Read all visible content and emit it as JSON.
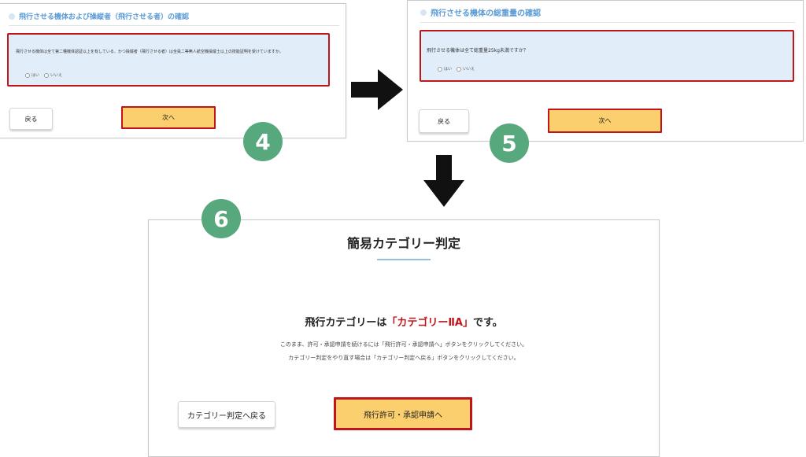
{
  "step4": {
    "badge": "4",
    "section_title": "飛行させる機体および操縦者（飛行させる者）の確認",
    "question": "飛行させる機体は全て第二種機体認証以上を有している、かつ操縦者（飛行させる者）は全員二等無人航空機操縦士以上の技能証明を受けていますか。",
    "option_yes": "はい",
    "option_no": "いいえ",
    "back_label": "戻る",
    "next_label": "次へ"
  },
  "step5": {
    "badge": "5",
    "section_title": "飛行させる機体の総重量の確認",
    "question": "飛行させる機体は全て総重量25kg未満ですか？",
    "option_yes": "はい",
    "option_no": "いいえ",
    "back_label": "戻る",
    "next_label": "次へ"
  },
  "step6": {
    "badge": "6",
    "title": "簡易カテゴリー判定",
    "result_prefix": "飛行カテゴリーは",
    "result_category": "「カテゴリーⅡA」",
    "result_suffix": "です。",
    "note_line1": "このまま、許可・承認申請を続けるには「飛行許可・承認申請へ」ボタンをクリックしてください。",
    "note_line2": "カテゴリー判定をやり直す場合は「カテゴリー判定へ戻る」ボタンをクリックしてください。",
    "back_label": "カテゴリー判定へ戻る",
    "apply_label": "飛行許可・承認申請へ"
  },
  "colors": {
    "highlight_border": "#c0161b",
    "button_yellow": "#fbcf6d",
    "badge_green": "#58a87e",
    "question_bg": "#e1edf9",
    "section_title_blue": "#5b9bd5"
  },
  "icons": {
    "arrow_right": "right-arrow-icon",
    "arrow_down": "down-arrow-icon",
    "radio": "radio-circle-icon"
  }
}
